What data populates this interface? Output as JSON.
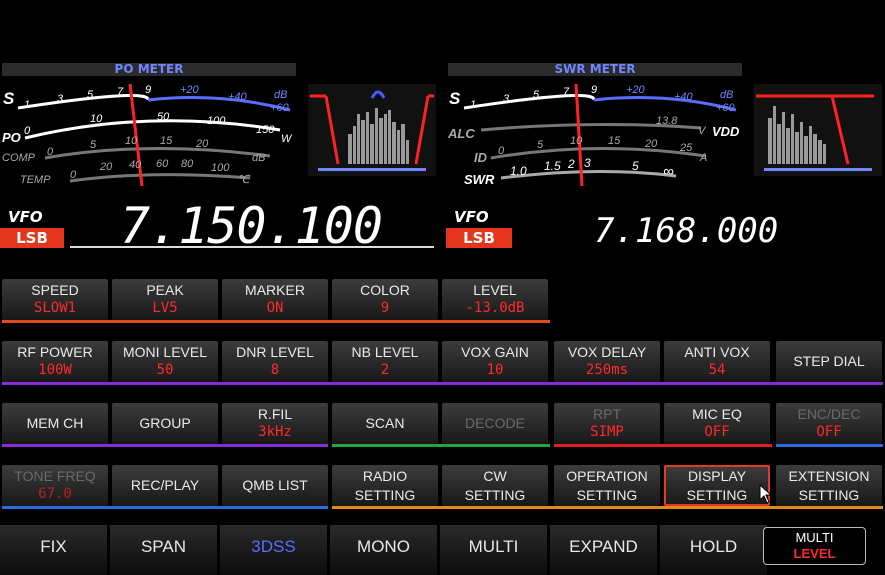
{
  "meters": {
    "left_title": "PO METER",
    "right_title": "SWR METER",
    "left": {
      "s_label": "S",
      "s_scale": [
        "1",
        "3",
        "5",
        "7",
        "9",
        "+20",
        "+40",
        "dB",
        "+60"
      ],
      "po_label": "PO",
      "po_scale": [
        "0",
        "10",
        "50",
        "100",
        "150",
        "W"
      ],
      "comp_label": "COMP",
      "comp_scale": [
        "0",
        "5",
        "10",
        "15",
        "20",
        "dB"
      ],
      "temp_label": "TEMP",
      "temp_scale": [
        "0",
        "20",
        "40",
        "60",
        "80",
        "100",
        "℃"
      ]
    },
    "right": {
      "s_label": "S",
      "s_scale": [
        "1",
        "3",
        "5",
        "7",
        "9",
        "+20",
        "+40",
        "dB",
        "+60"
      ],
      "alc_label": "ALC",
      "vdd_value": "13.8",
      "vdd_unit": "V",
      "vdd_label": "VDD",
      "id_label": "ID",
      "id_scale": [
        "0",
        "5",
        "10",
        "15",
        "20",
        "25",
        "A"
      ],
      "swr_label": "SWR",
      "swr_scale": [
        "1.0",
        "1.5",
        "2",
        "3",
        "5",
        "∞"
      ]
    }
  },
  "vfo": {
    "main_label": "VFO",
    "main_mode": "LSB",
    "main_freq": "7.150.100",
    "sub_label": "VFO",
    "sub_mode": "LSB",
    "sub_freq": "7.168.000"
  },
  "row1": [
    {
      "label": "SPEED",
      "value": "SLOW1"
    },
    {
      "label": "PEAK",
      "value": "LV5"
    },
    {
      "label": "MARKER",
      "value": "ON"
    },
    {
      "label": "COLOR",
      "value": "9"
    },
    {
      "label": "LEVEL",
      "value": "-13.0dB"
    }
  ],
  "row2": [
    {
      "label": "RF POWER",
      "value": "100W"
    },
    {
      "label": "MONI LEVEL",
      "value": "50"
    },
    {
      "label": "DNR LEVEL",
      "value": "8"
    },
    {
      "label": "NB LEVEL",
      "value": "2"
    },
    {
      "label": "VOX GAIN",
      "value": "10"
    },
    {
      "label": "VOX DELAY",
      "value": "250ms"
    },
    {
      "label": "ANTI VOX",
      "value": "54"
    },
    {
      "label": "STEP DIAL",
      "value": ""
    }
  ],
  "row3": [
    {
      "label": "MEM CH",
      "value": ""
    },
    {
      "label": "GROUP",
      "value": ""
    },
    {
      "label": "R.FIL",
      "value": "3kHz"
    },
    {
      "label": "SCAN",
      "value": ""
    },
    {
      "label": "DECODE",
      "value": ""
    },
    {
      "label": "RPT",
      "value": "SIMP"
    },
    {
      "label": "MIC EQ",
      "value": "OFF"
    },
    {
      "label": "ENC/DEC",
      "value": "OFF"
    }
  ],
  "row4": [
    {
      "label": "TONE FREQ",
      "value": "67.0"
    },
    {
      "label": "REC/PLAY",
      "value": ""
    },
    {
      "label": "QMB LIST",
      "value": ""
    },
    {
      "label1": "RADIO",
      "label2": "SETTING"
    },
    {
      "label1": "CW",
      "label2": "SETTING"
    },
    {
      "label1": "OPERATION",
      "label2": "SETTING"
    },
    {
      "label1": "DISPLAY",
      "label2": "SETTING"
    },
    {
      "label1": "EXTENSION",
      "label2": "SETTING"
    }
  ],
  "bottom": [
    "FIX",
    "SPAN",
    "3DSS",
    "MONO",
    "MULTI",
    "EXPAND",
    "HOLD"
  ],
  "bottom_last": {
    "line1": "MULTI",
    "line2": "LEVEL"
  },
  "colors": {
    "accent_red": "#e3361d",
    "value_red": "#ff2a2a",
    "meter_blue": "#6f86ff",
    "bottom_active": "#5b6cff"
  }
}
